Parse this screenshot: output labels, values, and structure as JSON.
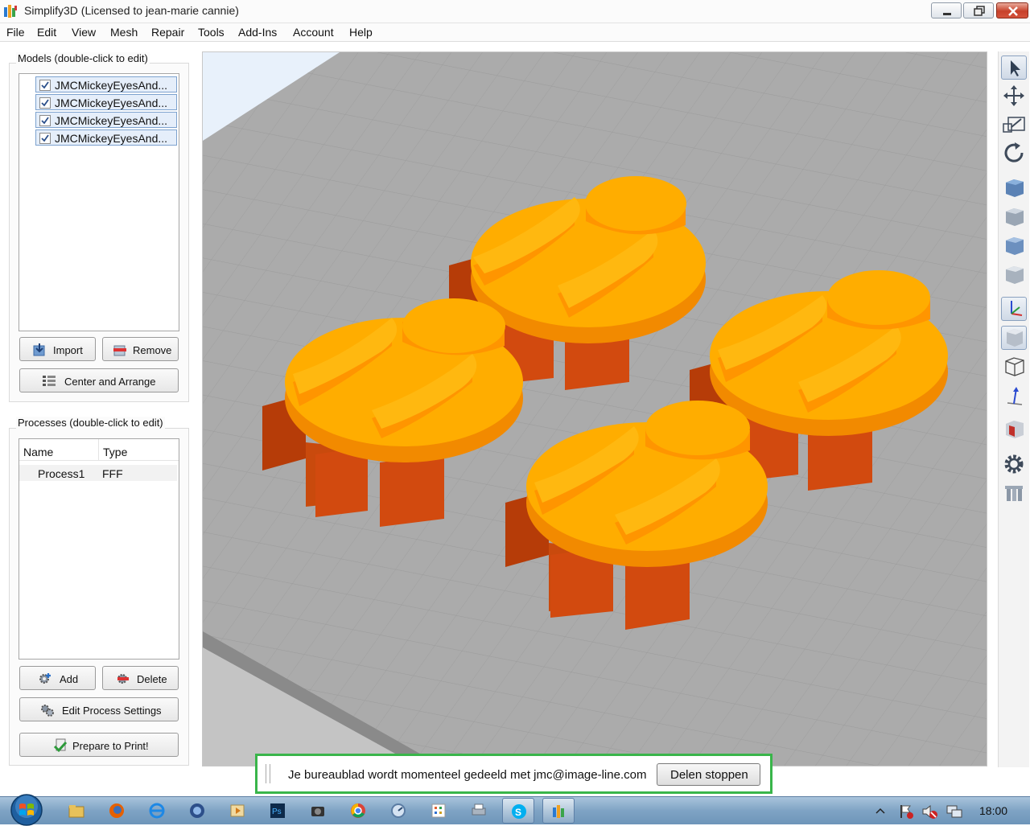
{
  "window": {
    "title": "Simplify3D (Licensed to jean-marie cannie)"
  },
  "menu": [
    "File",
    "Edit",
    "View",
    "Mesh",
    "Repair",
    "Tools",
    "Add-Ins",
    "Account",
    "Help"
  ],
  "models": {
    "label": "Models (double-click to edit)",
    "items": [
      {
        "name": "JMCMickeyEyesAnd...",
        "checked": true
      },
      {
        "name": "JMCMickeyEyesAnd...",
        "checked": true
      },
      {
        "name": "JMCMickeyEyesAnd...",
        "checked": true
      },
      {
        "name": "JMCMickeyEyesAnd...",
        "checked": true
      }
    ],
    "import_label": "Import",
    "remove_label": "Remove",
    "center_label": "Center and Arrange"
  },
  "processes": {
    "label": "Processes (double-click to edit)",
    "col_name": "Name",
    "col_type": "Type",
    "rows": [
      {
        "name": "Process1",
        "type": "FFF"
      }
    ],
    "add_label": "Add",
    "delete_label": "Delete",
    "edit_label": "Edit Process Settings",
    "prepare_label": "Prepare to Print!"
  },
  "share_banner": {
    "message": "Je bureaublad wordt momenteel gedeeld met jmc@image-line.com",
    "stop_label": "Delen stoppen"
  },
  "taskbar": {
    "clock": "18:00"
  },
  "colors": {
    "model_top": "#ffad00",
    "model_side": "#ff9500",
    "legs": "#d24a0f",
    "bed": "#ababab",
    "accent_green": "#39b54a"
  }
}
